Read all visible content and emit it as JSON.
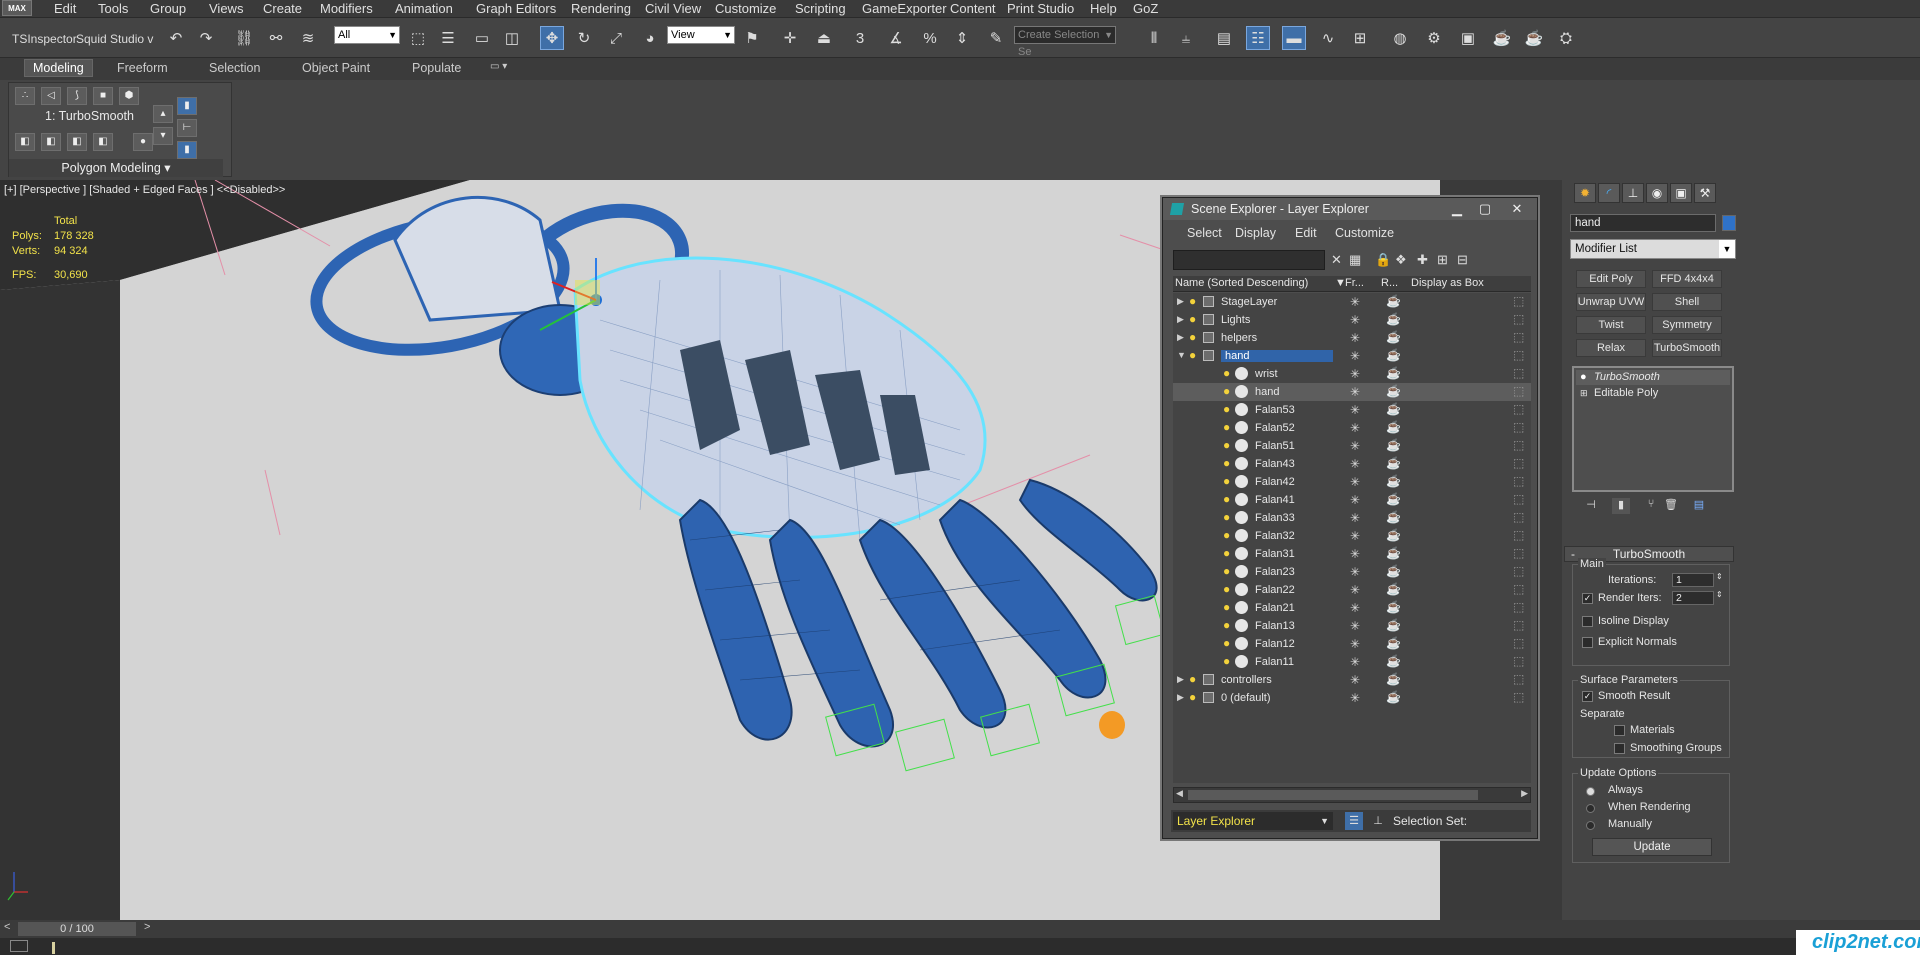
{
  "app": {
    "logo": "MAX"
  },
  "menu": [
    "Edit",
    "Tools",
    "Group",
    "Views",
    "Create",
    "Modifiers",
    "Animation",
    "Graph Editors",
    "Rendering",
    "Civil View",
    "Customize",
    "Scripting",
    "GameExporter",
    "Content",
    "Print Studio",
    "Help",
    "GoZ"
  ],
  "toolbar": {
    "inspector": "TSInspector",
    "studio": "Squid Studio v",
    "filter": "All",
    "view": "View",
    "snap_count": "3",
    "selection_set_placeholder": "Create Selection Se"
  },
  "ribbon": {
    "tabs": [
      "Modeling",
      "Freeform",
      "Selection",
      "Object Paint",
      "Populate"
    ],
    "active_tab": "Modeling",
    "modifier": "1: TurboSmooth",
    "panel_title": "Polygon Modeling"
  },
  "viewport": {
    "label": "[+] [Perspective ] [Shaded + Edged Faces ]  <<Disabled>>",
    "stats_header": "Total",
    "stats": [
      {
        "key": "Polys:",
        "value": "178 328"
      },
      {
        "key": "Verts:",
        "value": "94 324"
      }
    ],
    "fps_key": "FPS:",
    "fps_value": "30,690"
  },
  "scene_explorer": {
    "title": "Scene Explorer - Layer Explorer",
    "menu": [
      "Select",
      "Display",
      "Edit",
      "Customize"
    ],
    "columns": [
      "Name (Sorted Descending)",
      "Fr...",
      "R...",
      "Display as Box"
    ],
    "rows": [
      {
        "name": "StageLayer",
        "type": "layer",
        "level": 0,
        "expander": "▶"
      },
      {
        "name": "Lights",
        "type": "layer",
        "level": 0,
        "expander": "▶"
      },
      {
        "name": "helpers",
        "type": "layer",
        "level": 0,
        "expander": "▶"
      },
      {
        "name": "hand",
        "type": "layer",
        "level": 0,
        "expander": "▼",
        "highlight": true
      },
      {
        "name": "wrist",
        "type": "object",
        "level": 1
      },
      {
        "name": "hand",
        "type": "object",
        "level": 1,
        "selected": true
      },
      {
        "name": "Falan53",
        "type": "object",
        "level": 1
      },
      {
        "name": "Falan52",
        "type": "object",
        "level": 1
      },
      {
        "name": "Falan51",
        "type": "object",
        "level": 1
      },
      {
        "name": "Falan43",
        "type": "object",
        "level": 1
      },
      {
        "name": "Falan42",
        "type": "object",
        "level": 1
      },
      {
        "name": "Falan41",
        "type": "object",
        "level": 1
      },
      {
        "name": "Falan33",
        "type": "object",
        "level": 1
      },
      {
        "name": "Falan32",
        "type": "object",
        "level": 1
      },
      {
        "name": "Falan31",
        "type": "object",
        "level": 1
      },
      {
        "name": "Falan23",
        "type": "object",
        "level": 1
      },
      {
        "name": "Falan22",
        "type": "object",
        "level": 1
      },
      {
        "name": "Falan21",
        "type": "object",
        "level": 1
      },
      {
        "name": "Falan13",
        "type": "object",
        "level": 1
      },
      {
        "name": "Falan12",
        "type": "object",
        "level": 1
      },
      {
        "name": "Falan11",
        "type": "object",
        "level": 1
      },
      {
        "name": "controllers",
        "type": "layer",
        "level": 0,
        "expander": "▶"
      },
      {
        "name": "0 (default)",
        "type": "layer",
        "level": 0,
        "expander": "▶"
      }
    ],
    "explorer_mode": "Layer Explorer",
    "selection_set_label": "Selection Set:"
  },
  "command_panel": {
    "object_name": "hand",
    "object_color": "#2f72c8",
    "modifier_list": "Modifier List",
    "modifier_buttons": [
      "Edit Poly",
      "FFD 4x4x4",
      "Unwrap UVW",
      "Shell",
      "Twist",
      "Symmetry",
      "Relax",
      "TurboSmooth"
    ],
    "stack": [
      "TurboSmooth",
      "Editable Poly"
    ],
    "rollout": {
      "title": "TurboSmooth",
      "main_label": "Main",
      "iterations_label": "Iterations:",
      "iterations": "1",
      "render_iters_label": "Render Iters:",
      "render_iters": "2",
      "render_iters_checked": true,
      "isoline": "Isoline Display",
      "explicit": "Explicit Normals",
      "surface_label": "Surface Parameters",
      "smooth_result": "Smooth Result",
      "separate": "Separate",
      "materials": "Materials",
      "smoothing_groups": "Smoothing Groups",
      "update_label": "Update Options",
      "opt_always": "Always",
      "opt_rendering": "When Rendering",
      "opt_manually": "Manually",
      "update_button": "Update"
    }
  },
  "timeline": {
    "frame": "0 / 100"
  },
  "watermark": "clip2net.com"
}
